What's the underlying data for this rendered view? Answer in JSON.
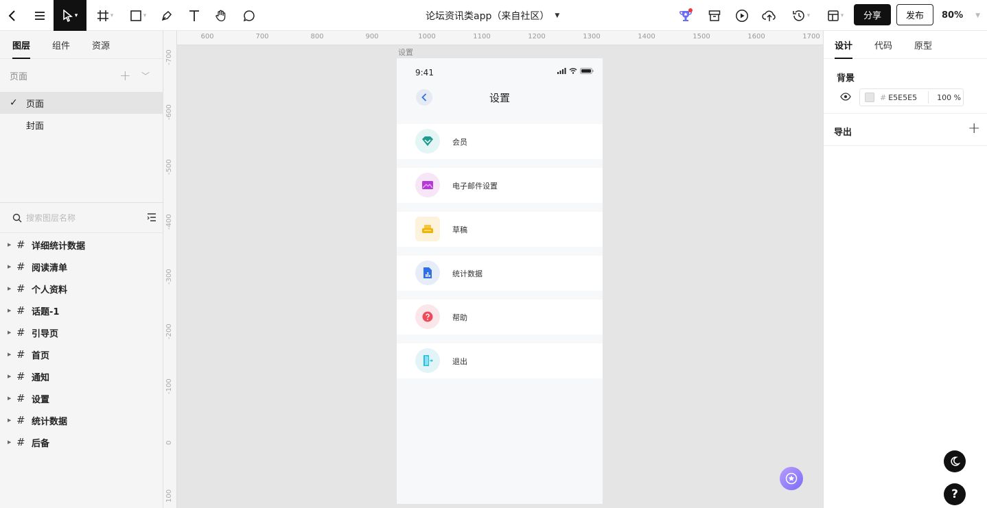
{
  "document": {
    "title": "论坛资讯类app（来自社区）"
  },
  "toolbar": {
    "share_label": "分享",
    "publish_label": "发布",
    "zoom": "80%"
  },
  "left_panel": {
    "tabs": [
      {
        "label": "图层"
      },
      {
        "label": "组件"
      },
      {
        "label": "资源"
      }
    ],
    "pages_header": "页面",
    "pages": [
      {
        "label": "页面",
        "active": true
      },
      {
        "label": "封面",
        "active": false
      }
    ],
    "search_placeholder": "搜索图层名称",
    "layers": [
      {
        "label": "详细统计数据"
      },
      {
        "label": "阅读清单"
      },
      {
        "label": "个人资料"
      },
      {
        "label": "话题-1"
      },
      {
        "label": "引导页"
      },
      {
        "label": "首页"
      },
      {
        "label": "通知"
      },
      {
        "label": "设置"
      },
      {
        "label": "统计数据"
      },
      {
        "label": "后备"
      }
    ]
  },
  "canvas": {
    "ruler_top": [
      "600",
      "700",
      "800",
      "900",
      "1000",
      "1100",
      "1200",
      "1300",
      "1400",
      "1500",
      "1600",
      "1700"
    ],
    "ruler_left": [
      "-700",
      "-600",
      "-500",
      "-400",
      "-300",
      "-200",
      "-100",
      "0",
      "100"
    ],
    "frame_label": "设置",
    "phone": {
      "time": "9:41",
      "title": "设置",
      "menu": [
        {
          "label": "会员",
          "icon": "diamond-icon",
          "bg": "#e3f5f5",
          "color": "#1f9c8f"
        },
        {
          "label": "电子邮件设置",
          "icon": "mail-icon",
          "bg": "#f7e6f7",
          "color": "#b43ad6"
        },
        {
          "label": "草稿",
          "icon": "draft-icon",
          "bg": "#fdf3dc",
          "color": "#f5c542"
        },
        {
          "label": "统计数据",
          "icon": "stats-icon",
          "bg": "#e6ecf8",
          "color": "#2f6fe8"
        },
        {
          "label": "帮助",
          "icon": "help-icon",
          "bg": "#fbe6ea",
          "color": "#ee4a5a"
        },
        {
          "label": "退出",
          "icon": "logout-icon",
          "bg": "#e2f4f8",
          "color": "#22c0de"
        }
      ]
    }
  },
  "right_panel": {
    "tabs": [
      {
        "label": "设计"
      },
      {
        "label": "代码"
      },
      {
        "label": "原型"
      }
    ],
    "background_title": "背景",
    "background_hash": "#",
    "background_hex": "E5E5E5",
    "background_opacity": "100 %",
    "export_title": "导出",
    "help_label": "?"
  }
}
